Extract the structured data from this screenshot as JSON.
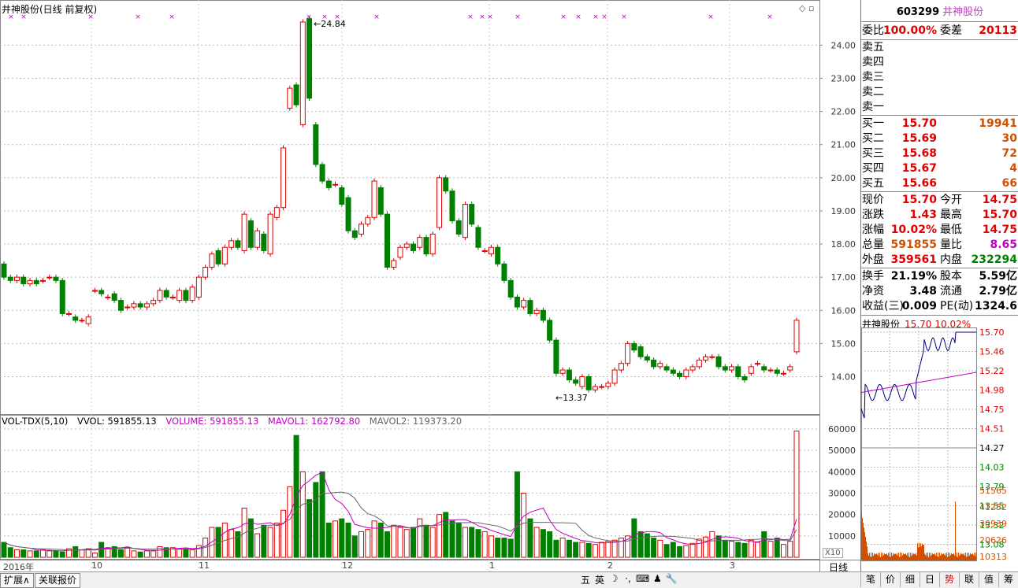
{
  "chart_header": {
    "title": "井神股份(日线 前复权)",
    "max_label": "24.84",
    "min_label": "13.37"
  },
  "price_axis": [
    "24.00",
    "23.00",
    "22.00",
    "21.00",
    "20.00",
    "19.00",
    "18.00",
    "17.00",
    "16.00",
    "15.00",
    "14.00"
  ],
  "volume_header": {
    "name": "VOL-TDX(5,10)",
    "vvol": "VVOL: 591855.13",
    "volume": "VOLUME: 591855.13",
    "mavol1": "MAVOL1: 162792.80",
    "mavol2": "MAVOL2: 119373.20"
  },
  "volume_axis": [
    "60000",
    "50000",
    "40000",
    "30000",
    "20000",
    "10000"
  ],
  "x10_label": "X10",
  "timeline": {
    "labels": [
      "2016年",
      "10",
      "11",
      "12",
      "1",
      "2",
      "3"
    ],
    "period": "日线"
  },
  "bottom_tabs": [
    "扩展∧",
    "关联报价"
  ],
  "ime": [
    "五",
    "英",
    "☽",
    "·,",
    "⌨",
    "♟",
    "🔧"
  ],
  "panel": {
    "code": "603299",
    "name": "井神股份",
    "weibi": {
      "label": "委比",
      "value": "100.00%",
      "label2": "委差",
      "value2": "20113"
    },
    "sell": [
      {
        "label": "卖五"
      },
      {
        "label": "卖四"
      },
      {
        "label": "卖三"
      },
      {
        "label": "卖二"
      },
      {
        "label": "卖一"
      }
    ],
    "buy": [
      {
        "label": "买一",
        "price": "15.70",
        "vol": "19941"
      },
      {
        "label": "买二",
        "price": "15.69",
        "vol": "30"
      },
      {
        "label": "买三",
        "price": "15.68",
        "vol": "72"
      },
      {
        "label": "买四",
        "price": "15.67",
        "vol": "4"
      },
      {
        "label": "买五",
        "price": "15.66",
        "vol": "66"
      }
    ],
    "quote": [
      {
        "l1": "现价",
        "v1": "15.70",
        "l2": "今开",
        "v2": "14.75"
      },
      {
        "l1": "涨跌",
        "v1": "1.43",
        "l2": "最高",
        "v2": "15.70"
      },
      {
        "l1": "涨幅",
        "v1": "10.02%",
        "l2": "最低",
        "v2": "14.75"
      },
      {
        "l1": "总量",
        "v1": "591855",
        "l2": "量比",
        "v2": "8.65"
      },
      {
        "l1": "外盘",
        "v1": "359561",
        "l2": "内盘",
        "v2": "232294"
      }
    ],
    "fund": [
      {
        "l1": "换手",
        "v1": "21.19%",
        "l2": "股本",
        "v2": "5.59亿"
      },
      {
        "l1": "净资",
        "v1": "3.48",
        "l2": "流通",
        "v2": "2.79亿"
      },
      {
        "l1": "收益(三)",
        "v1": "0.009",
        "l2": "PE(动)",
        "v2": "1324.6"
      }
    ],
    "mini": {
      "name": "井神股份",
      "price": "15.70",
      "change": "10.02%",
      "price_axis": [
        "15.70",
        "15.46",
        "15.22",
        "14.98",
        "14.75",
        "14.51",
        "14.27",
        "14.03",
        "13.79",
        "13.55",
        "13.32",
        "13.08"
      ],
      "vol_axis": [
        "51565",
        "41252",
        "30939",
        "20626",
        "10313"
      ]
    },
    "tabs": [
      "笔",
      "价",
      "细",
      "日",
      "势",
      "联",
      "值",
      "筹"
    ],
    "active_tab": "势"
  },
  "colors": {
    "up": "#e00000",
    "down": "#008000",
    "ma1": "#c000c0",
    "ma2": "#666666"
  }
}
